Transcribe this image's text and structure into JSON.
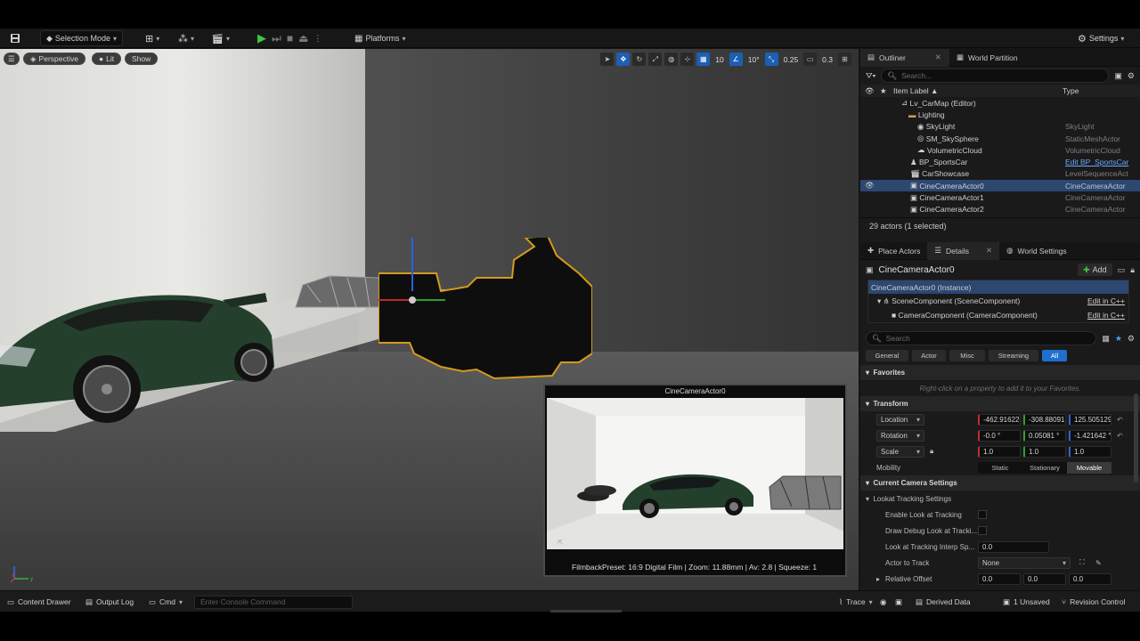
{
  "toolbar": {
    "selection_mode": "Selection Mode",
    "platforms": "Platforms",
    "settings": "Settings"
  },
  "viewport": {
    "perspective": "Perspective",
    "lit": "Lit",
    "show": "Show",
    "grid_snap": "10",
    "rot_snap": "10°",
    "scale_snap": "0.25",
    "cam_speed": "0.3",
    "axis_x": "x",
    "axis_y": "y"
  },
  "pip": {
    "title": "CineCameraActor0",
    "footer": "FilmbackPreset: 16:9 Digital Film | Zoom: 11.88mm | Av: 2.8 | Squeeze: 1"
  },
  "outliner": {
    "tab": "Outliner",
    "tab2": "World Partition",
    "search_placeholder": "Search...",
    "col_label": "Item Label ▲",
    "col_type": "Type",
    "rows": [
      {
        "label": "Lv_CarMap (Editor)",
        "type": ""
      },
      {
        "label": "Lighting",
        "type": ""
      },
      {
        "label": "SkyLight",
        "type": "SkyLight"
      },
      {
        "label": "SM_SkySphere",
        "type": "StaticMeshActor"
      },
      {
        "label": "VolumetricCloud",
        "type": "VolumetricCloud"
      },
      {
        "label": "BP_SportsCar",
        "type": "Edit BP_SportsCar"
      },
      {
        "label": "CarShowcase",
        "type": "LevelSequenceAct"
      },
      {
        "label": "CineCameraActor0",
        "type": "CineCameraActor"
      },
      {
        "label": "CineCameraActor1",
        "type": "CineCameraActor"
      },
      {
        "label": "CineCameraActor2",
        "type": "CineCameraActor"
      }
    ],
    "status": "29 actors (1 selected)"
  },
  "details": {
    "tab_place": "Place Actors",
    "tab_details": "Details",
    "tab_world": "World Settings",
    "actor_name": "CineCameraActor0",
    "add_label": "Add",
    "instance": "CineCameraActor0 (Instance)",
    "scene_comp": "SceneComponent (SceneComponent)",
    "camera_comp": "CameraComponent (CameraComponent)",
    "edit_cpp": "Edit in C++",
    "search_placeholder": "Search",
    "categories": [
      "General",
      "Actor",
      "Misc",
      "Streaming",
      "All"
    ],
    "favorites": "Favorites",
    "favorites_hint": "Right-click on a property to add it to your Favorites.",
    "transform": "Transform",
    "location_label": "Location",
    "location": [
      "-462.916229",
      "-308.880916",
      "125.505129"
    ],
    "rotation_label": "Rotation",
    "rotation": [
      "-0.0 °",
      "0.05081 °",
      "-1.421642 °"
    ],
    "scale_label": "Scale",
    "scale": [
      "1.0",
      "1.0",
      "1.0"
    ],
    "mobility_label": "Mobility",
    "mobility_options": [
      "Static",
      "Stationary",
      "Movable"
    ],
    "current_camera": "Current Camera Settings",
    "lookat": "Lookat Tracking Settings",
    "enable_lookat": "Enable Look at Tracking",
    "draw_debug": "Draw Debug Look at Tracki...",
    "interp_speed_label": "Look at Tracking Interp Sp...",
    "interp_speed": "0.0",
    "actor_to_track_label": "Actor to Track",
    "actor_to_track": "None",
    "relative_offset_label": "Relative Offset",
    "relative_offset": [
      "0.0",
      "0.0",
      "0.0"
    ]
  },
  "bottombar": {
    "content_drawer": "Content Drawer",
    "output_log": "Output Log",
    "cmd": "Cmd",
    "console_placeholder": "Enter Console Command",
    "trace": "Trace",
    "derived_data": "Derived Data",
    "unsaved": "1 Unsaved",
    "revision": "Revision Control"
  }
}
